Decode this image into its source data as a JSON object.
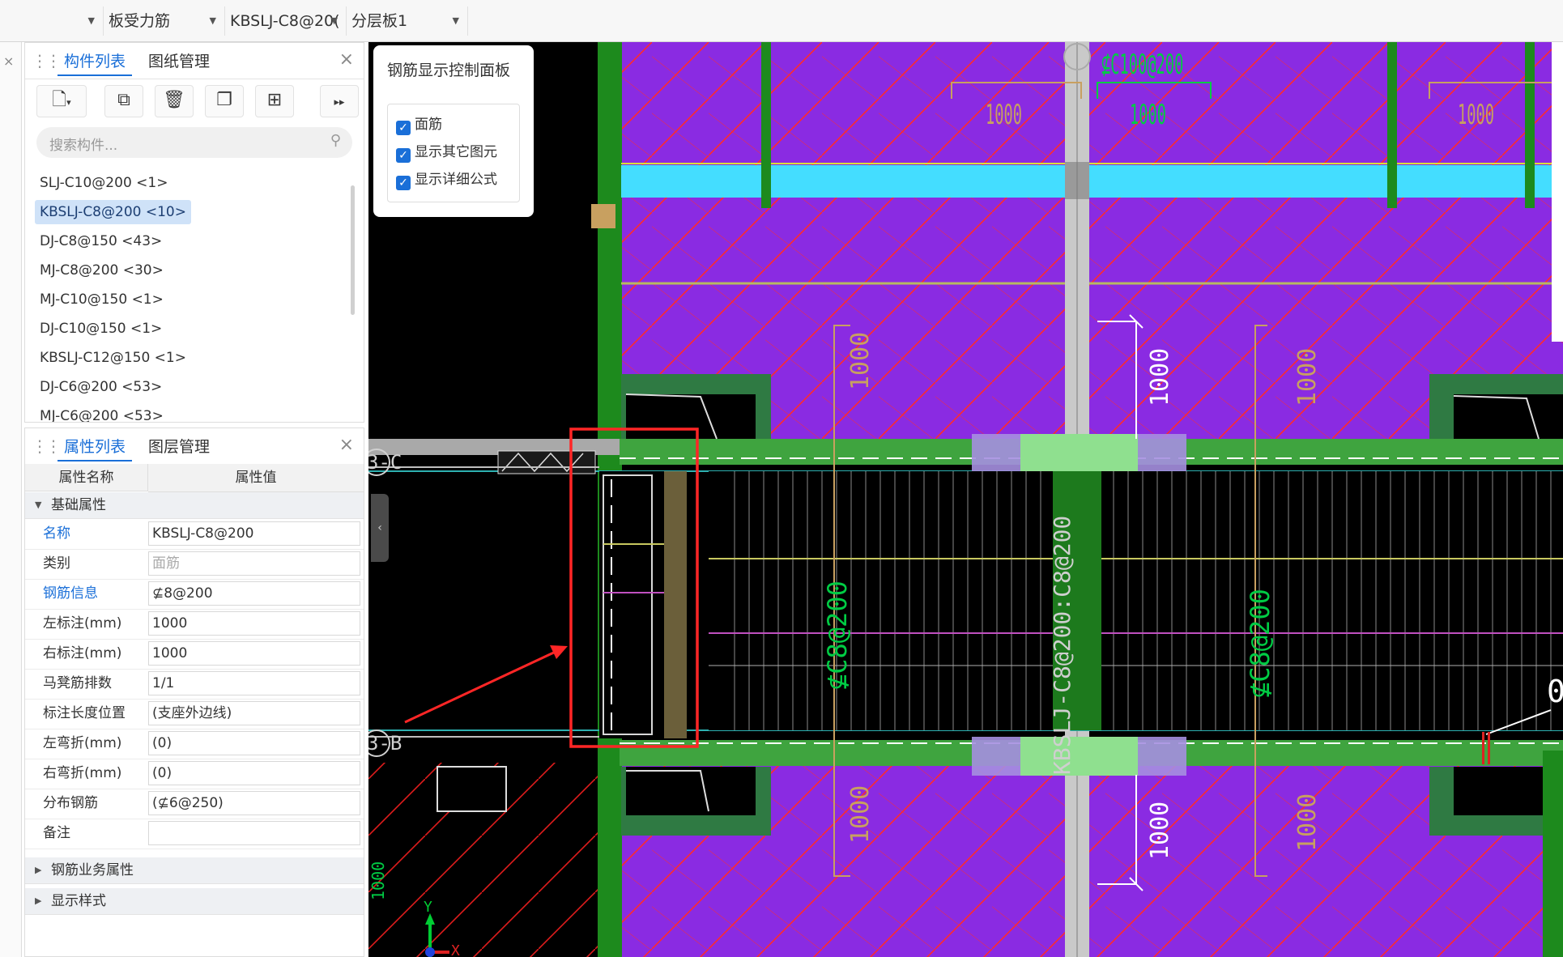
{
  "toolbar": {
    "dropdowns": [
      {
        "value": "",
        "icon": "chevron-down-icon"
      },
      {
        "value": "板受力筋",
        "icon": "chevron-down-icon"
      },
      {
        "value": "KBSLJ-C8@20(",
        "icon": "chevron-down-icon"
      },
      {
        "value": "分层板1",
        "icon": "chevron-down-icon"
      }
    ]
  },
  "component_panel": {
    "tabs": [
      "构件列表",
      "图纸管理"
    ],
    "active_tab": "构件列表",
    "tools": [
      "new-icon",
      "copy-icon",
      "delete-icon",
      "duplicate-icon",
      "layer-copy-icon",
      "more-icon"
    ],
    "search_placeholder": "搜索构件...",
    "items": [
      "SLJ-C10@200 <1>",
      "KBSLJ-C8@200 <10>",
      "DJ-C8@150 <43>",
      "MJ-C8@200 <30>",
      "MJ-C10@150 <1>",
      "DJ-C10@150 <1>",
      "KBSLJ-C12@150 <1>",
      "DJ-C6@200 <53>",
      "MJ-C6@200 <53>"
    ],
    "selected_index": 1
  },
  "property_panel": {
    "tabs": [
      "属性列表",
      "图层管理"
    ],
    "active_tab": "属性列表",
    "headers": [
      "属性名称",
      "属性值"
    ],
    "group_basic": "基础属性",
    "rows": [
      {
        "name": "名称",
        "value": "KBSLJ-C8@200",
        "blue": true
      },
      {
        "name": "类别",
        "value": "面筋",
        "gray": true
      },
      {
        "name": "钢筋信息",
        "value": "⊈8@200",
        "blue": true
      },
      {
        "name": "左标注(mm)",
        "value": "1000"
      },
      {
        "name": "右标注(mm)",
        "value": "1000"
      },
      {
        "name": "马凳筋排数",
        "value": "1/1"
      },
      {
        "name": "标注长度位置",
        "value": "(支座外边线)"
      },
      {
        "name": "左弯折(mm)",
        "value": "(0)"
      },
      {
        "name": "右弯折(mm)",
        "value": "(0)"
      },
      {
        "name": "分布钢筋",
        "value": "(⊈6@250)"
      },
      {
        "name": "备注",
        "value": ""
      }
    ],
    "group_business": "钢筋业务属性",
    "group_style": "显示样式"
  },
  "rebar_control_panel": {
    "title": "钢筋显示控制面板",
    "options": [
      {
        "label": "面筋",
        "checked": true
      },
      {
        "label": "显示其它图元",
        "checked": true
      },
      {
        "label": "显示详细公式",
        "checked": true
      }
    ]
  },
  "cad": {
    "axis_labels": [
      "3-C",
      "3-B"
    ],
    "top_label": "⊈C100@200",
    "dims": [
      "1000",
      "1000",
      "1000",
      "1000",
      "1000",
      "1000",
      "1000",
      "1000",
      "1000",
      "1000"
    ],
    "rebar_vertical": "KBSLJ-C8@200:C8@200",
    "rebar_left": "⊈C8@200",
    "rebar_right": "⊈C8@200",
    "y_axis": "Y",
    "x_axis": "X",
    "edge_char": "0",
    "colors": {
      "slab": "#8a2be2",
      "beam": "#1d8a1d",
      "highlight": "#ff3333",
      "cyan": "#44ddff"
    }
  }
}
